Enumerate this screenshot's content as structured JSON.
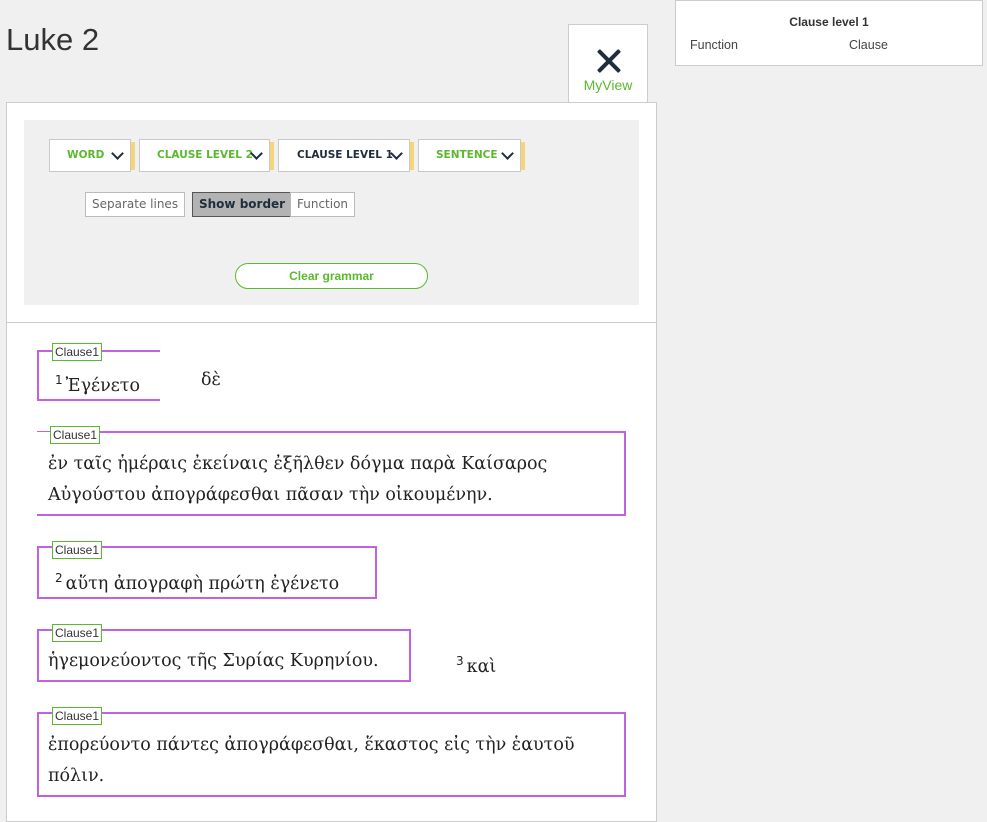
{
  "page": {
    "title": "Luke 2"
  },
  "tab": {
    "label": "MyView",
    "icon": "close-icon"
  },
  "dropdowns": [
    {
      "label": "WORD"
    },
    {
      "label": "CLAUSE LEVEL 2"
    },
    {
      "label": "CLAUSE LEVEL 1"
    },
    {
      "label": "SENTENCE"
    }
  ],
  "toggles": {
    "separate_lines": "Separate lines",
    "show_border": "Show border",
    "function": "Function"
  },
  "clear_button": "Clear grammar",
  "info": {
    "title": "Clause level 1",
    "col1": "Function",
    "col2": "Clause"
  },
  "clause_tag": "Clause1",
  "text": {
    "c1_verse": "1",
    "c1_word": "Ἐγένετο",
    "c1_de": "δὲ",
    "c2_line1": "ἐν ταῖς ἡμέραις ἐκείναις ἐξῆλθεν δόγμα παρὰ Καίσαρος",
    "c2_line2": "Αὐγούστου ἀπογράφεσθαι πᾶσαν τὴν οἰκουμένην.",
    "c3_verse": "2",
    "c3_text": "αὕτη ἀπογραφὴ πρώτη ἐγένετο",
    "c4_text": "ἡγεμονεύοντος τῆς Συρίας Κυρηνίου.",
    "c4_verse": "3",
    "c4_kai": "καὶ",
    "c5_line1": "ἐπορεύοντο πάντες ἀπογράφεσθαι, ἕκαστος εἰς τὴν ἑαυτοῦ",
    "c5_line2": "πόλιν."
  },
  "colors": {
    "accent_green": "#5cb82f",
    "clause_border": "#c163e0",
    "highlight_yellow": "#f5d57a",
    "dark": "#1f2d3d"
  }
}
